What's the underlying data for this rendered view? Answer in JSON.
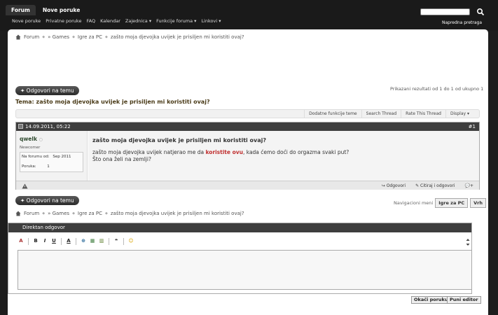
{
  "header": {
    "tabs": [
      {
        "label": "Forum"
      },
      {
        "label": "Nove poruke"
      }
    ],
    "subnav": [
      "Nove poruke",
      "Privatne poruke",
      "FAQ",
      "Kalendar",
      "Zajednica ▾",
      "Funkcije foruma ▾",
      "Linkovi ▾"
    ],
    "advanced_search": "Napredna pretraga",
    "search_placeholder": ""
  },
  "breadcrumb": [
    "Forum",
    "» Games",
    "Igre za PC",
    "zašto moja djevojka uvijek je prisiljen mi koristiti ovaj?"
  ],
  "actions": {
    "reply_label": "✦ Odgovori na temu",
    "results": "Prikazani rezultati od 1 do 1 od ukupno 1"
  },
  "thread": {
    "title": "Tema: zašto moja djevojka uvijek je prisiljen mi koristiti ovaj?",
    "tools": [
      "Dodatne funkcije teme",
      "Search Thread",
      "Rate This Thread",
      "Display ▾"
    ]
  },
  "post": {
    "date": "14.09.2011, 05:22",
    "number": "#1",
    "username": "qwelk",
    "usertitle": "Newcomer",
    "stats": [
      {
        "label": "Na forumu od:",
        "value": "Sep 2011"
      },
      {
        "label": "Poruka:",
        "value": "1"
      }
    ],
    "title": "zašto moja djevojka uvijek je prisiljen mi koristiti ovaj?",
    "line1_before": "zašto moja djevojka uvijek natjerao me da ",
    "line1_link": "koristite ovu",
    "line1_after": ", kada ćemo doći do orgazma svaki put?",
    "line2": "Što ona želi na zemlji?",
    "footer_actions": [
      "Odgovori",
      "Citiraj i odgovori"
    ]
  },
  "nav_menu": {
    "label": "Navigacioni meni",
    "current": "Igre za PC",
    "top": "Vrh"
  },
  "quick_reply": {
    "title": "Direktan odgovor",
    "toolbar": [
      "A",
      "B",
      "I",
      "U",
      "A",
      "⊕",
      "▦",
      "▥",
      "❝",
      "☺"
    ],
    "buttons": [
      "Okači poruku",
      "Puni editor"
    ]
  },
  "colors": {
    "topbar": "#1a1a1a",
    "post_header": "#3e3e3e",
    "link_highlight": "#c03030",
    "title": "#4a3b18"
  }
}
